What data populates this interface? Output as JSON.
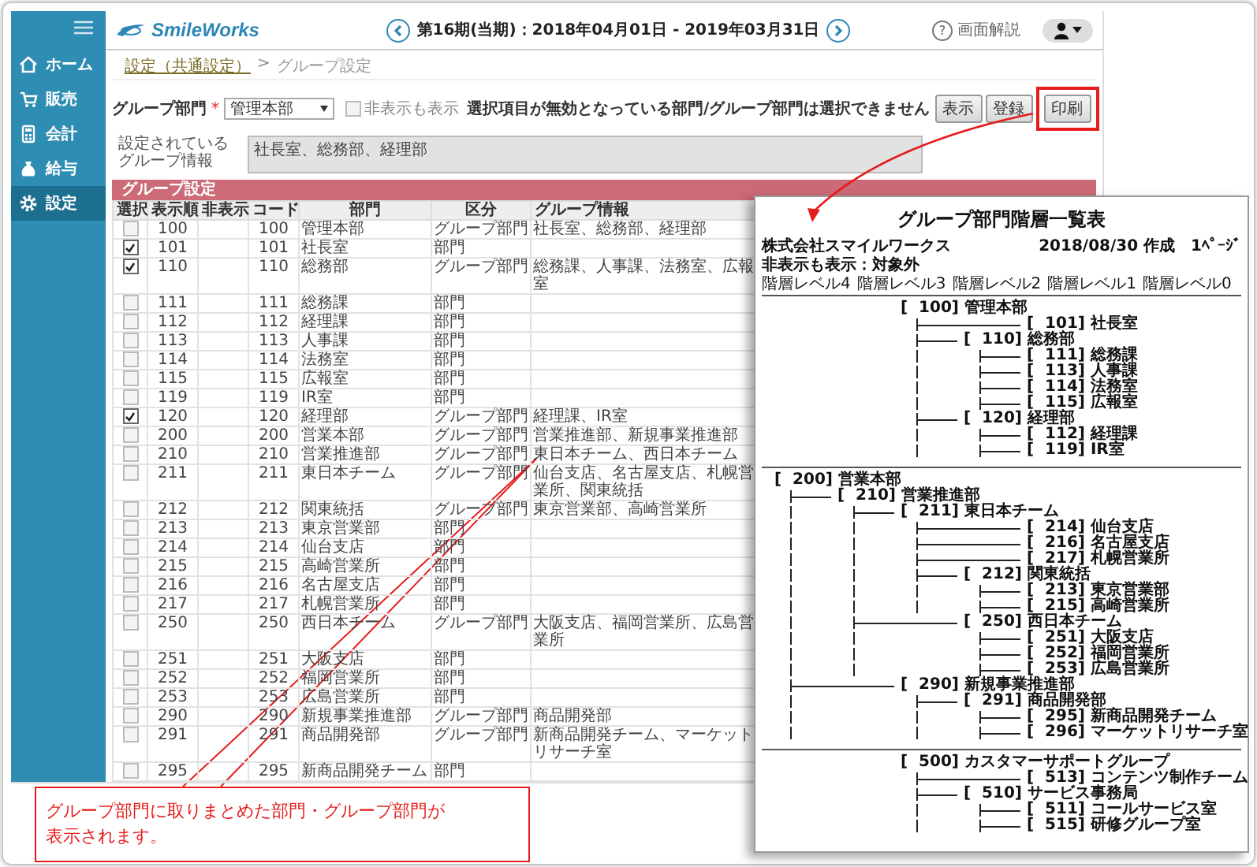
{
  "sidebar": {
    "items": [
      {
        "label": "ホーム",
        "selected": false
      },
      {
        "label": "販売",
        "selected": false
      },
      {
        "label": "会計",
        "selected": false
      },
      {
        "label": "給与",
        "selected": false
      },
      {
        "label": "設定",
        "selected": true
      }
    ]
  },
  "header": {
    "logo": "SmileWorks",
    "period": "第16期(当期)：2018年04月01日 - 2019年03月31日",
    "help_icon": "?",
    "help": "画面解説"
  },
  "breadcrumb": [
    {
      "label": "設定（共通設定）",
      "kind": "link"
    },
    {
      "label": ">",
      "kind": "separator"
    },
    {
      "label": "グループ設定",
      "kind": "current"
    }
  ],
  "form": {
    "group_label": "グループ部門",
    "required_mark": "*",
    "group_value": "管理本部",
    "show_hidden": {
      "label": "非表示も表示",
      "checked": false
    },
    "notice": "選択項目が無効となっている部門/グループ部門は選択できません",
    "buttons": [
      {
        "label": "表示",
        "highlighted": false
      },
      {
        "label": "登録",
        "highlighted": false
      },
      {
        "label": "印刷",
        "highlighted": true
      }
    ],
    "info_label": [
      "設定されている",
      "グループ情報"
    ],
    "info_value": "社長室、総務部、経理部"
  },
  "table": {
    "title": "グループ設定",
    "columns": [
      "選択",
      "表示順",
      "非表示",
      "コード",
      "部門",
      "区分",
      "グループ情報"
    ],
    "rows": [
      {
        "checked": false,
        "order": "100",
        "code": "100",
        "name": "管理本部",
        "category": "グループ部門",
        "info": "社長室、総務部、経理部"
      },
      {
        "checked": true,
        "order": "101",
        "code": "101",
        "name": "社長室",
        "category": "部門"
      },
      {
        "checked": true,
        "order": "110",
        "code": "110",
        "name": "総務部",
        "category": "グループ部門",
        "info": "総務課、人事課、法務室、広報室"
      },
      {
        "checked": false,
        "order": "111",
        "code": "111",
        "name": "総務課",
        "category": "部門"
      },
      {
        "checked": false,
        "order": "112",
        "code": "112",
        "name": "経理課",
        "category": "部門"
      },
      {
        "checked": false,
        "order": "113",
        "code": "113",
        "name": "人事課",
        "category": "部門"
      },
      {
        "checked": false,
        "order": "114",
        "code": "114",
        "name": "法務室",
        "category": "部門"
      },
      {
        "checked": false,
        "order": "115",
        "code": "115",
        "name": "広報室",
        "category": "部門"
      },
      {
        "checked": false,
        "order": "119",
        "code": "119",
        "name": "IR室",
        "category": "部門"
      },
      {
        "checked": true,
        "order": "120",
        "code": "120",
        "name": "経理部",
        "category": "グループ部門",
        "info": "経理課、IR室"
      },
      {
        "checked": false,
        "order": "200",
        "code": "200",
        "name": "営業本部",
        "category": "グループ部門",
        "info": "営業推進部、新規事業推進部"
      },
      {
        "checked": false,
        "order": "210",
        "code": "210",
        "name": "営業推進部",
        "category": "グループ部門",
        "info": "東日本チーム、西日本チーム"
      },
      {
        "checked": false,
        "order": "211",
        "code": "211",
        "name": "東日本チーム",
        "category": "グループ部門",
        "info": "仙台支店、名古屋支店、札幌営業所、関東統括"
      },
      {
        "checked": false,
        "order": "212",
        "code": "212",
        "name": "関東統括",
        "category": "グループ部門",
        "info": "東京営業部、高崎営業所"
      },
      {
        "checked": false,
        "order": "213",
        "code": "213",
        "name": "東京営業部",
        "category": "部門"
      },
      {
        "checked": false,
        "order": "214",
        "code": "214",
        "name": "仙台支店",
        "category": "部門"
      },
      {
        "checked": false,
        "order": "215",
        "code": "215",
        "name": "高崎営業所",
        "category": "部門"
      },
      {
        "checked": false,
        "order": "216",
        "code": "216",
        "name": "名古屋支店",
        "category": "部門"
      },
      {
        "checked": false,
        "order": "217",
        "code": "217",
        "name": "札幌営業所",
        "category": "部門"
      },
      {
        "checked": false,
        "order": "250",
        "code": "250",
        "name": "西日本チーム",
        "category": "グループ部門",
        "info": "大阪支店、福岡営業所、広島営業所"
      },
      {
        "checked": false,
        "order": "251",
        "code": "251",
        "name": "大阪支店",
        "category": "部門"
      },
      {
        "checked": false,
        "order": "252",
        "code": "252",
        "name": "福岡営業所",
        "category": "部門"
      },
      {
        "checked": false,
        "order": "253",
        "code": "253",
        "name": "広島営業所",
        "category": "部門"
      },
      {
        "checked": false,
        "order": "290",
        "code": "290",
        "name": "新規事業推進部",
        "category": "グループ部門",
        "info": "商品開発部"
      },
      {
        "checked": false,
        "order": "291",
        "code": "291",
        "name": "商品開発部",
        "category": "グループ部門",
        "info": "新商品開発チーム、マーケットリサーチ室"
      },
      {
        "checked": false,
        "order": "295",
        "code": "295",
        "name": "新商品開発チーム",
        "category": "部門"
      }
    ]
  },
  "report": {
    "title": "グループ部門階層一覧表",
    "company": "株式会社スマイルワークス",
    "date": "2018/08/30 作成",
    "page": "1ﾍﾟｰｼﾞ",
    "filter": "非表示も表示：対象外",
    "levels": [
      "階層レベル4",
      "階層レベル3",
      "階層レベル2",
      "階層レベル1",
      "階層レベル0"
    ],
    "blocks": [
      {
        "label": "[  100] 管理本部",
        "children": [
          {
            "label": "[  101] 社長室"
          },
          {
            "label": "[  110] 総務部",
            "children": [
              {
                "label": "[  111] 総務課"
              },
              {
                "label": "[  113] 人事課"
              },
              {
                "label": "[  114] 法務室"
              },
              {
                "label": "[  115] 広報室"
              }
            ]
          },
          {
            "label": "[  120] 経理部",
            "children": [
              {
                "label": "[  112] 経理課"
              },
              {
                "label": "[  119] IR室"
              }
            ]
          }
        ]
      },
      {
        "label": "[  200] 営業本部",
        "children": [
          {
            "label": "[  210] 営業推進部",
            "children": [
              {
                "label": "[  211] 東日本チーム",
                "children": [
                  {
                    "label": "[  214] 仙台支店"
                  },
                  {
                    "label": "[  216] 名古屋支店"
                  },
                  {
                    "label": "[  217] 札幌営業所"
                  },
                  {
                    "label": "[  212] 関東統括",
                    "children": [
                      {
                        "label": "[  213] 東京営業部"
                      },
                      {
                        "label": "[  215] 高崎営業所"
                      }
                    ]
                  }
                ]
              },
              {
                "label": "[  250] 西日本チーム",
                "children": [
                  {
                    "label": "[  251] 大阪支店"
                  },
                  {
                    "label": "[  252] 福岡営業所"
                  },
                  {
                    "label": "[  253] 広島営業所"
                  }
                ]
              }
            ]
          },
          {
            "label": "[  290] 新規事業推進部",
            "children": [
              {
                "label": "[  291] 商品開発部",
                "children": [
                  {
                    "label": "[  295] 新商品開発チーム"
                  },
                  {
                    "label": "[  296] マーケットリサーチ室"
                  }
                ]
              }
            ]
          }
        ]
      },
      {
        "label": "[  500] カスタマーサポートグループ",
        "children": [
          {
            "label": "[  513] コンテンツ制作チーム"
          },
          {
            "label": "[  510] サービス事務局",
            "children": [
              {
                "label": "[  511] コールサービス室"
              },
              {
                "label": "[  515] 研修グループ室"
              }
            ]
          }
        ]
      }
    ]
  },
  "callout": {
    "lines": [
      "グループ部門に取りまとめた部門・グループ部門が",
      "表示されます。"
    ]
  }
}
